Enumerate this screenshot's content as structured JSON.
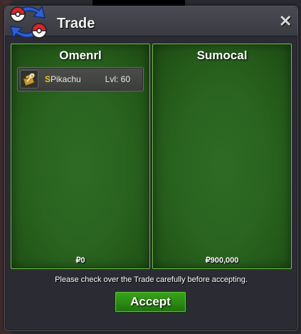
{
  "window": {
    "title": "Trade",
    "close_symbol": "✕"
  },
  "left_panel": {
    "player_name": "Omenrl",
    "money": "₽0",
    "items": [
      {
        "icon": "box-with-key-icon",
        "shiny_marker": "S",
        "name": "Pikachu",
        "level": "Lvl: 60"
      }
    ]
  },
  "right_panel": {
    "player_name": "Sumocal",
    "money": "₽900,000"
  },
  "footer": {
    "notice": "Please check over the Trade carefully before accepting.",
    "accept_label": "Accept"
  },
  "colors": {
    "panel_green": "#2a6420",
    "panel_border": "#6cbf3f",
    "accept_green": "#2a8a12",
    "shiny_gold": "#e8c72a"
  }
}
